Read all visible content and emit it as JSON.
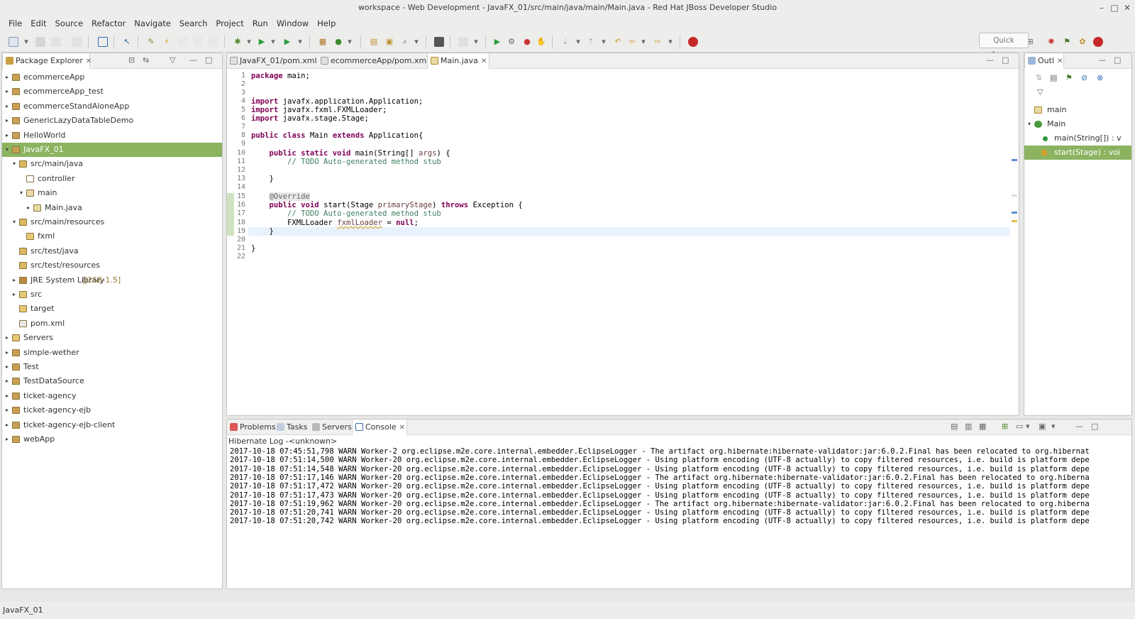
{
  "window": {
    "title": "workspace - Web Development - JavaFX_01/src/main/java/main/Main.java - Red Hat JBoss Developer Studio",
    "minimize": "–",
    "maximize": "□",
    "close": "✕"
  },
  "menu": [
    "File",
    "Edit",
    "Source",
    "Refactor",
    "Navigate",
    "Search",
    "Project",
    "Run",
    "Window",
    "Help"
  ],
  "toolbar": {
    "quick_access": "Quick Access"
  },
  "package_explorer": {
    "title": "Package Explorer",
    "items": [
      {
        "label": "ecommerceApp",
        "depth": 0,
        "twisty": "▸",
        "icon": "project-icon"
      },
      {
        "label": "ecommerceApp_test",
        "depth": 0,
        "twisty": "▸",
        "icon": "project-icon"
      },
      {
        "label": "ecommerceStandAloneApp",
        "depth": 0,
        "twisty": "▸",
        "icon": "project-icon"
      },
      {
        "label": "GenericLazyDataTableDemo",
        "depth": 0,
        "twisty": "▸",
        "icon": "project-icon"
      },
      {
        "label": "HelloWorld",
        "depth": 0,
        "twisty": "▸",
        "icon": "project-icon"
      },
      {
        "label": "JavaFX_01",
        "depth": 0,
        "twisty": "▾",
        "icon": "project-icon",
        "selected": true
      },
      {
        "label": "src/main/java",
        "depth": 1,
        "twisty": "▾",
        "icon": "source-folder-icon"
      },
      {
        "label": "controller",
        "depth": 2,
        "twisty": "",
        "icon": "package-empty-icon"
      },
      {
        "label": "main",
        "depth": 2,
        "twisty": "▾",
        "icon": "package-icon"
      },
      {
        "label": "Main.java",
        "depth": 3,
        "twisty": "▸",
        "icon": "java-file-icon"
      },
      {
        "label": "src/main/resources",
        "depth": 1,
        "twisty": "▾",
        "icon": "source-folder-icon"
      },
      {
        "label": "fxml",
        "depth": 2,
        "twisty": "",
        "icon": "folder-icon"
      },
      {
        "label": "src/test/java",
        "depth": 1,
        "twisty": "",
        "icon": "source-folder-icon"
      },
      {
        "label": "src/test/resources",
        "depth": 1,
        "twisty": "",
        "icon": "source-folder-icon"
      },
      {
        "label": "JRE System Library",
        "decoration": " [J2SE-1.5]",
        "depth": 1,
        "twisty": "▸",
        "icon": "library-icon"
      },
      {
        "label": "src",
        "depth": 1,
        "twisty": "▸",
        "icon": "folder-icon"
      },
      {
        "label": "target",
        "depth": 1,
        "twisty": "",
        "icon": "folder-icon"
      },
      {
        "label": "pom.xml",
        "depth": 1,
        "twisty": "",
        "icon": "xml-file-icon"
      },
      {
        "label": "Servers",
        "depth": 0,
        "twisty": "▸",
        "icon": "folder-icon"
      },
      {
        "label": "simple-wether",
        "depth": 0,
        "twisty": "▸",
        "icon": "project-icon"
      },
      {
        "label": "Test",
        "depth": 0,
        "twisty": "▸",
        "icon": "project-icon"
      },
      {
        "label": "TestDataSource",
        "depth": 0,
        "twisty": "▸",
        "icon": "project-icon"
      },
      {
        "label": "ticket-agency",
        "depth": 0,
        "twisty": "▸",
        "icon": "project-icon"
      },
      {
        "label": "ticket-agency-ejb",
        "depth": 0,
        "twisty": "▸",
        "icon": "project-icon"
      },
      {
        "label": "ticket-agency-ejb-client",
        "depth": 0,
        "twisty": "▸",
        "icon": "project-icon"
      },
      {
        "label": "webApp",
        "depth": 0,
        "twisty": "▸",
        "icon": "project-icon"
      }
    ]
  },
  "editor": {
    "tabs": [
      {
        "label": "JavaFX_01/pom.xml",
        "active": false
      },
      {
        "label": "ecommerceApp/pom.xml",
        "active": false
      },
      {
        "label": "Main.java",
        "active": true
      }
    ],
    "line_numbers": [
      "1",
      "2",
      "3",
      "4",
      "5",
      "6",
      "7",
      "8",
      "9",
      "10",
      "11",
      "12",
      "13",
      "14",
      "15",
      "16",
      "17",
      "18",
      "19",
      "20",
      "21",
      "22"
    ]
  },
  "outline": {
    "title": "Outl",
    "items": [
      {
        "label": "main",
        "icon": "package-icon"
      },
      {
        "label": "Main",
        "icon": "class-icon"
      },
      {
        "label": "main(String[]) : v",
        "icon": "public-static-method-icon"
      },
      {
        "label": "start(Stage) : voi",
        "icon": "public-method-icon",
        "selected": true
      }
    ]
  },
  "bottom": {
    "tabs": [
      {
        "label": "Problems",
        "active": false
      },
      {
        "label": "Tasks",
        "active": false
      },
      {
        "label": "Servers",
        "active": false
      },
      {
        "label": "Console",
        "active": true
      }
    ],
    "console_title": "Hibernate Log -<unknown>",
    "lines": [
      "2017-10-18 07:45:51,798 WARN Worker-2 org.eclipse.m2e.core.internal.embedder.EclipseLogger - The artifact org.hibernate:hibernate-validator:jar:6.0.2.Final has been relocated to org.hibernat",
      "2017-10-18 07:51:14,500 WARN Worker-20 org.eclipse.m2e.core.internal.embedder.EclipseLogger - Using platform encoding (UTF-8 actually) to copy filtered resources, i.e. build is platform depe",
      "2017-10-18 07:51:14,548 WARN Worker-20 org.eclipse.m2e.core.internal.embedder.EclipseLogger - Using platform encoding (UTF-8 actually) to copy filtered resources, i.e. build is platform depe",
      "2017-10-18 07:51:17,146 WARN Worker-20 org.eclipse.m2e.core.internal.embedder.EclipseLogger - The artifact org.hibernate:hibernate-validator:jar:6.0.2.Final has been relocated to org.hiberna",
      "2017-10-18 07:51:17,472 WARN Worker-20 org.eclipse.m2e.core.internal.embedder.EclipseLogger - Using platform encoding (UTF-8 actually) to copy filtered resources, i.e. build is platform depe",
      "2017-10-18 07:51:17,473 WARN Worker-20 org.eclipse.m2e.core.internal.embedder.EclipseLogger - Using platform encoding (UTF-8 actually) to copy filtered resources, i.e. build is platform depe",
      "2017-10-18 07:51:19,962 WARN Worker-20 org.eclipse.m2e.core.internal.embedder.EclipseLogger - The artifact org.hibernate:hibernate-validator:jar:6.0.2.Final has been relocated to org.hiberna",
      "2017-10-18 07:51:20,741 WARN Worker-20 org.eclipse.m2e.core.internal.embedder.EclipseLogger - Using platform encoding (UTF-8 actually) to copy filtered resources, i.e. build is platform depe",
      "2017-10-18 07:51:20,742 WARN Worker-20 org.eclipse.m2e.core.internal.embedder.EclipseLogger - Using platform encoding (UTF-8 actually) to copy filtered resources, i.e. build is platform depe"
    ]
  },
  "statusbar": {
    "text": "JavaFX_01"
  },
  "colors": {
    "selection": "#8bb360",
    "keyword": "#7f0055",
    "comment": "#3f7f5f",
    "outline_selection": "#8bb360"
  }
}
